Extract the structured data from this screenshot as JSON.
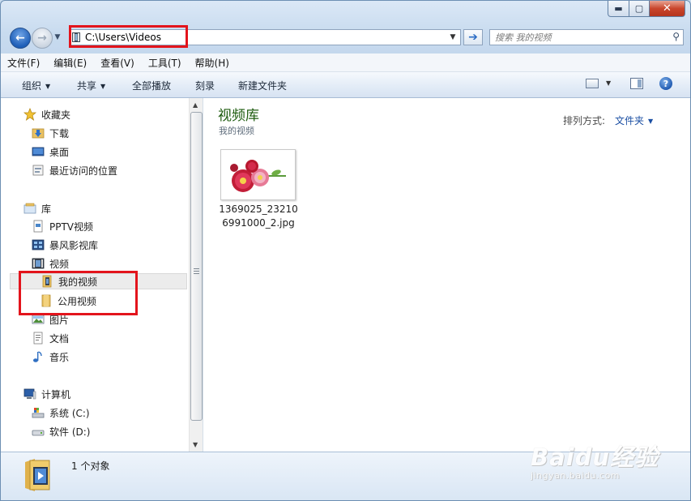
{
  "window": {
    "caption_buttons": {
      "minimize": "▬",
      "maximize": "▢",
      "close": "✕"
    }
  },
  "nav": {
    "back_glyph": "←",
    "forward_glyph": "→",
    "address_path": "C:\\Users\\Videos",
    "go_glyph": "➔",
    "search_placeholder": "搜索 我的视频"
  },
  "menubar": [
    "文件(F)",
    "编辑(E)",
    "查看(V)",
    "工具(T)",
    "帮助(H)"
  ],
  "commandbar": {
    "organize": "组织",
    "share": "共享",
    "play_all": "全部播放",
    "burn": "刻录",
    "new_folder": "新建文件夹",
    "help": "?"
  },
  "navpane": {
    "favorites": {
      "label": "收藏夹",
      "items": [
        "下载",
        "桌面",
        "最近访问的位置"
      ]
    },
    "libraries": {
      "label": "库",
      "items": [
        "PPTV视频",
        "暴风影视库",
        "视频",
        "我的视频",
        "公用视频",
        "图片",
        "文档",
        "音乐"
      ]
    },
    "computer": {
      "label": "计算机",
      "items": [
        "系统 (C:)",
        "软件 (D:)"
      ]
    }
  },
  "content": {
    "library_title": "视频库",
    "library_subtitle": "我的视频",
    "arrange_label": "排列方式:",
    "arrange_value": "文件夹",
    "files": [
      {
        "name": "1369025_232106991000_2.jpg",
        "icon": "flower-thumbnail"
      }
    ]
  },
  "statusbar": {
    "text": "1 个对象",
    "icon": "video-folder-icon"
  },
  "watermark": {
    "main": "Baidu经验",
    "sub": "jingyan.baidu.com"
  },
  "colors": {
    "highlight_box": "#e3141c",
    "library_title": "#1e5c0f",
    "link_blue": "#1b4fa3"
  }
}
